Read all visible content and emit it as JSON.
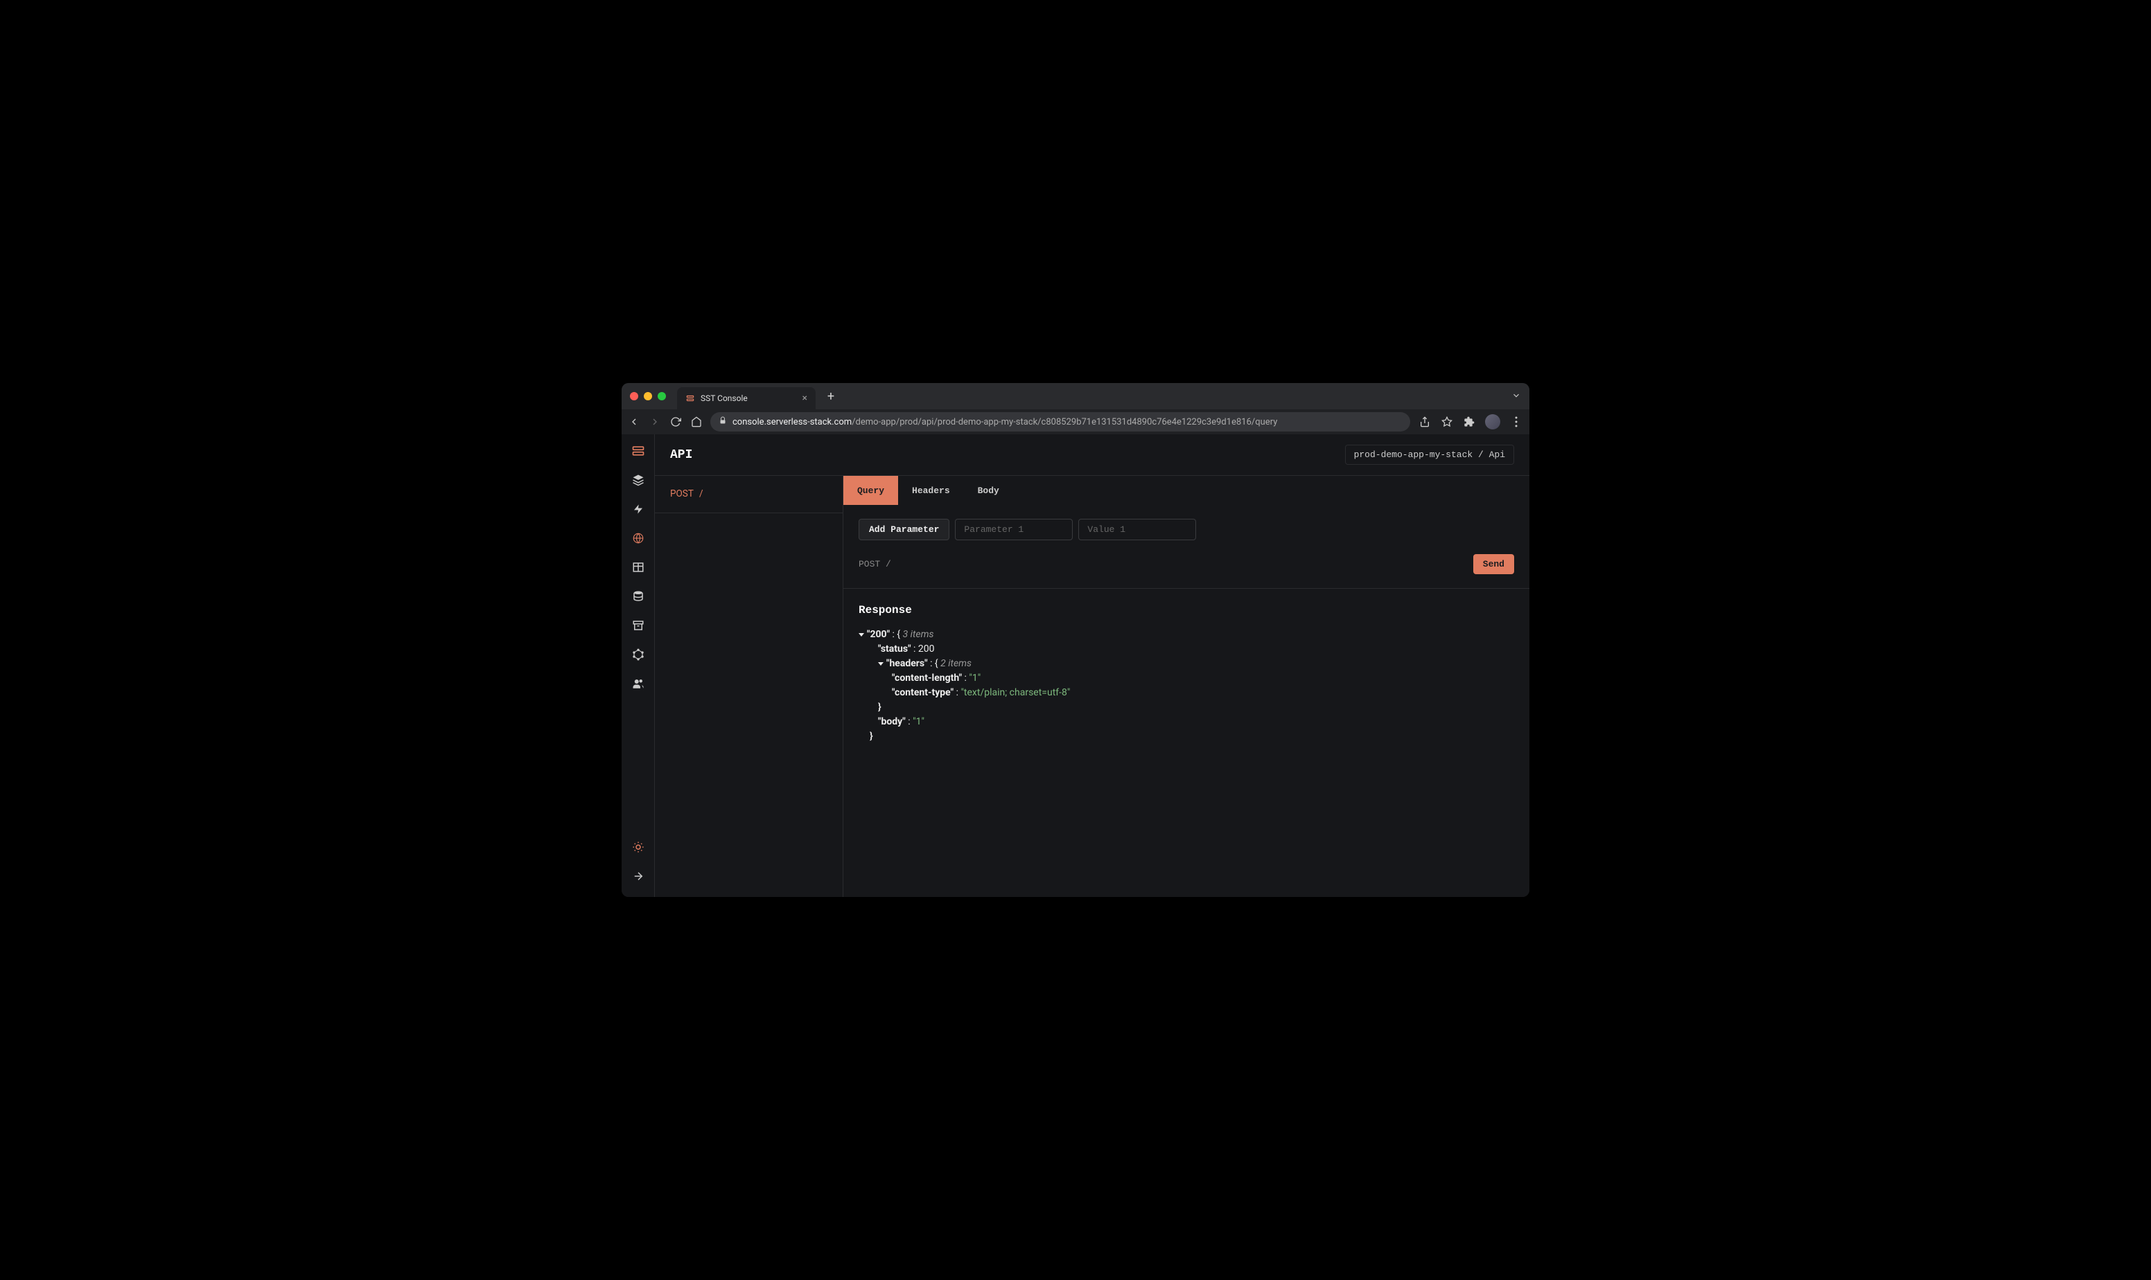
{
  "browser": {
    "tab_title": "SST Console",
    "url_host": "console.serverless-stack.com",
    "url_path": "/demo-app/prod/api/prod-demo-app-my-stack/c808529b71e131531d4890c76e4e1229c3e9d1e816/query"
  },
  "header": {
    "title": "API",
    "breadcrumb": "prod-demo-app-my-stack / Api"
  },
  "routes": [
    {
      "method": "POST",
      "path": "/"
    }
  ],
  "request": {
    "tabs": [
      "Query",
      "Headers",
      "Body"
    ],
    "active_tab": "Query",
    "add_param_label": "Add Parameter",
    "param_placeholder": "Parameter 1",
    "value_placeholder": "Value 1",
    "method_path": "POST /",
    "send_label": "Send"
  },
  "response": {
    "title": "Response",
    "root_key": "200",
    "root_items": "3 items",
    "status_key": "status",
    "status_value": 200,
    "headers_key": "headers",
    "headers_items": "2 items",
    "headers": {
      "content-length": "1",
      "content-type": "text/plain; charset=utf-8"
    },
    "body_key": "body",
    "body_value": "1"
  }
}
